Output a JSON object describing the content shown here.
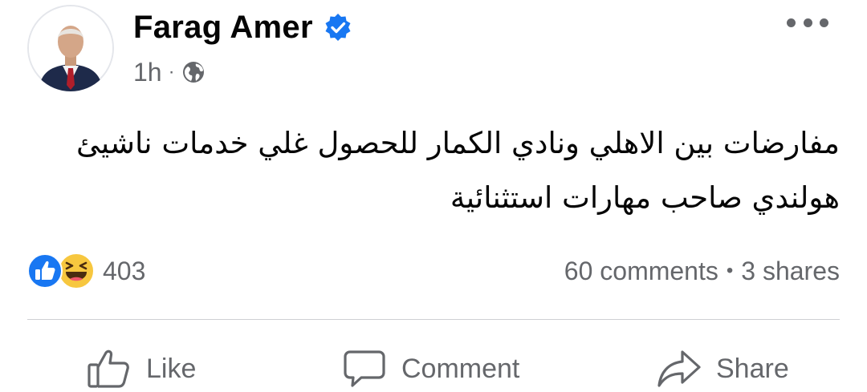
{
  "post": {
    "author": "Farag Amer",
    "time": "1h",
    "meta_separator": "·",
    "audience_icon": "globe-icon",
    "verified_icon": "verified-badge-icon",
    "more_icon": "more-options-icon",
    "text_lines": [
      "مفارضات بين الاهلي ونادي الكمار للحصول غلي خدمات ناشيئ",
      "هولندي صاحب مهارات استثنائية"
    ]
  },
  "engagement": {
    "reaction_icons": [
      "like-reaction-icon",
      "haha-reaction-icon"
    ],
    "reaction_count": "403",
    "comments": "60 comments",
    "separator": "•",
    "shares": "3 shares"
  },
  "actions": {
    "like_label": "Like",
    "comment_label": "Comment",
    "share_label": "Share"
  },
  "colors": {
    "text_primary": "#050505",
    "text_secondary": "#65676b",
    "accent_blue": "#1877f2",
    "divider": "#ced0d4",
    "haha_yellow": "#f7c73f"
  }
}
